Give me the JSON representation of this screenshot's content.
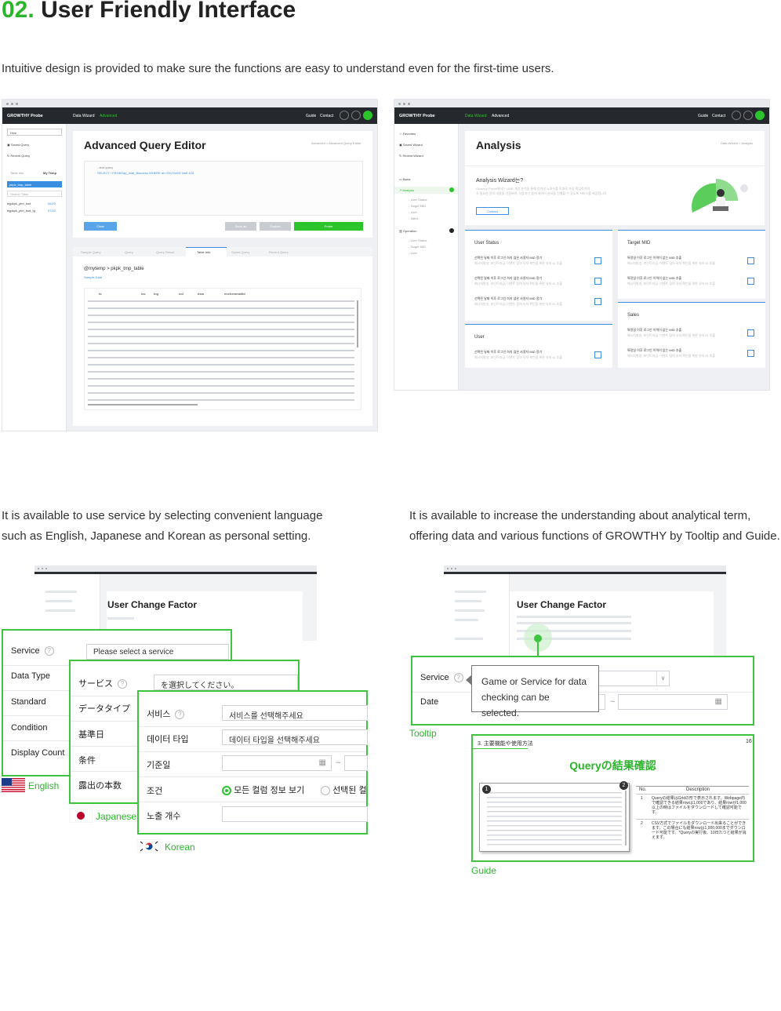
{
  "header": {
    "number": "02.",
    "title": "User Friendly Interface",
    "intro": "Intuitive design is provided to make sure the functions are easy to understand even for the first-time users."
  },
  "shot1": {
    "brand": "GROWTHY Probe",
    "nav": [
      "Data Wizard",
      "Advanced"
    ],
    "nav_right": [
      "Guide",
      "Contact"
    ],
    "side_select": "Hive",
    "side_items": [
      "Saved Query",
      "Recent Query"
    ],
    "side_tabs": [
      "Table Info",
      "My Temp"
    ],
    "side_db": "pkpk_tmp_table",
    "side_search": "Search Table",
    "side_tables": [
      {
        "name": "bgpkpk_plm_bsd",
        "date": "06/20"
      },
      {
        "name": "bgpkpk_plm_bsd_tg",
        "date": "07/20"
      }
    ],
    "page_title": "Advanced Query Editor",
    "crumb": "Advanced  >  Advanced Query Editor",
    "editor_line1": "--test query",
    "editor_line2": "SELECT * FROM tap_mail_filaccess WHERE dt='20170420' limit 100",
    "buttons": {
      "clear": "Clear",
      "save": "Save as",
      "explain": "Explain",
      "probe": "Probe"
    },
    "tabs": [
      "Sample Query",
      "Query",
      "Query Result",
      "Table Info",
      "Saved Query",
      "Recent Query"
    ],
    "table_path": "@mytemp  >  pkpk_tmp_table",
    "sample_link": "Sample Data",
    "cols": [
      "ts",
      "loc",
      "lng",
      "cid",
      "dsm",
      "enchemmailid"
    ]
  },
  "shot2": {
    "brand": "GROWTHY Probe",
    "nav": [
      "Data Wizard",
      "Advanced"
    ],
    "nav_right": [
      "Guide",
      "Contact"
    ],
    "side_top": [
      "Favorites",
      "Saved Wizard",
      "Recent Wizard"
    ],
    "side_basic": "Basic",
    "side_analysis": "Analysis",
    "side_sub1": [
      "User Status",
      "Target MID",
      "User",
      "Sales"
    ],
    "side_operation": "Operation",
    "side_sub2": [
      "User Status",
      "Target MID",
      "User"
    ],
    "page_title": "Analysis",
    "crumb": "Data Wizard  >  Analysis",
    "wizard_title": "Analysis Wizard는?",
    "wizard_desc1": "Growthy Probe에서는 LINE 게임 분석을 통해 얻어낸 노하우를 토대로 가장 핵심적이며",
    "wizard_desc2": "꼭 필요한 분석 내용을 선정하여, 사용자가 쉽게 데이터 분석을 진행할 수 있도록 서비스를 제공합니다.",
    "contact": "Contact",
    "sections": [
      "User Status",
      "Target MID",
      "User",
      "Sales"
    ],
    "item_title": "선택된 날짜 이후 로그인 하지 않은 사용자 MID 정기",
    "item_sub": "메시지발송, 포인트지급, 이벤트 참여 유저 확인을 위한 유저 ID 추출",
    "item_title2": "특정일 이후 로그인 이력이 없는 MID 추출",
    "item_sub2": "메시지발송, 포인트지급, 이벤트 참여 유저 확인을 위한 유저 ID 추출"
  },
  "caption_left": [
    "It is available to use service by selecting convenient language",
    "such as English, Japanese and Korean as personal setting."
  ],
  "caption_right": [
    "It is available to increase the understanding about analytical term,",
    "offering data and various functions of GROWTHY by Tooltip and Guide."
  ],
  "lang": {
    "card_title": "User Change Factor",
    "english": {
      "labels": [
        "Service",
        "Data Type",
        "Standard",
        "Condition",
        "Display Count"
      ],
      "placeholder": "Please select a service",
      "tag": "English"
    },
    "japanese": {
      "labels": [
        "サービス",
        "データタイプ",
        "基準日",
        "条件",
        "露出の本数"
      ],
      "placeholder": "を選択してください。",
      "tag": "Japanese"
    },
    "korean": {
      "labels": [
        "서비스",
        "데이터 타입",
        "기준일",
        "조건",
        "노출 개수"
      ],
      "service_placeholder": "서비스를 선택해주세요",
      "type_placeholder": "데이터 타입을 선택해주세요",
      "radio1": "모든 컬럼 정보 보기",
      "radio2": "선택된 컬",
      "tilde": "~",
      "tag": "Korean"
    }
  },
  "help": {
    "card_title": "User Change Factor",
    "labels": [
      "Service",
      "Date"
    ],
    "tilde": "~",
    "tooltip": "Game or Service for data checking can be selected.",
    "tooltip_tag": "Tooltip",
    "guide_section": "3. 主要機能や使用方法",
    "guide_page": "16",
    "guide_title": "Queryの結果確認",
    "guide_cols": [
      "No.",
      "Description"
    ],
    "guide_rows": [
      {
        "no": "1",
        "desc": "Queryの結果はGridの形で表示されます。Webpage内で確認できる結果rowは1,000であり、結果rowが1,000以上の時はファイルをダウンロードして確認可能です。"
      },
      {
        "no": "2",
        "desc": "CSV方式でファイルをダウンロード出来ることができます。この場合にも結果rowは1,000,000までダウンロード可能です。*Queryの実行後、10日たつと結果が消えます。"
      }
    ],
    "badges": [
      "1",
      "2"
    ],
    "guide_tag": "Guide"
  },
  "colors": {
    "accent": "#2bb52b",
    "frame_green": "#3ec43e",
    "nav_dark": "#25282c",
    "link_blue": "#3b8de0"
  }
}
